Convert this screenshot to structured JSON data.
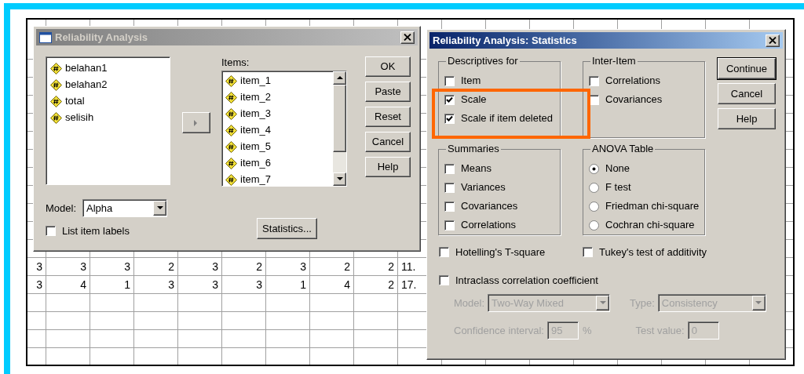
{
  "spreadsheet": {
    "rows": [
      {
        "cells": [
          "3",
          "3",
          "3",
          "2",
          "3",
          "2",
          "3",
          "2",
          "2",
          "11."
        ]
      },
      {
        "cells": [
          "3",
          "4",
          "1",
          "3",
          "3",
          "3",
          "1",
          "4",
          "2",
          "17."
        ]
      }
    ]
  },
  "analysis_dialog": {
    "title": "Reliability Analysis",
    "active": false,
    "variables": [
      {
        "name": "belahan1"
      },
      {
        "name": "belahan2"
      },
      {
        "name": "total"
      },
      {
        "name": "selisih"
      }
    ],
    "items_label": "Items:",
    "items": [
      {
        "name": "item_1"
      },
      {
        "name": "item_2"
      },
      {
        "name": "item_3"
      },
      {
        "name": "item_4"
      },
      {
        "name": "item_5"
      },
      {
        "name": "item_6"
      },
      {
        "name": "item_7"
      }
    ],
    "model_label": "Model:",
    "model_value": "Alpha",
    "list_item_labels": {
      "label": "List item labels",
      "checked": false
    },
    "buttons": [
      "OK",
      "Paste",
      "Reset",
      "Cancel",
      "Help"
    ],
    "statistics_button": "Statistics..."
  },
  "statistics_dialog": {
    "title": "Reliability Analysis: Statistics",
    "active": true,
    "groups": [
      {
        "title": "Descriptives for",
        "kind": "checkbox",
        "options": [
          {
            "label": "Item",
            "checked": false
          },
          {
            "label": "Scale",
            "checked": true
          },
          {
            "label": "Scale if item deleted",
            "checked": true
          }
        ]
      },
      {
        "title": "Inter-Item",
        "kind": "checkbox",
        "options": [
          {
            "label": "Correlations",
            "checked": false
          },
          {
            "label": "Covariances",
            "checked": false
          }
        ]
      },
      {
        "title": "Summaries",
        "kind": "checkbox",
        "options": [
          {
            "label": "Means",
            "checked": false
          },
          {
            "label": "Variances",
            "checked": false
          },
          {
            "label": "Covariances",
            "checked": false
          },
          {
            "label": "Correlations",
            "checked": false
          }
        ]
      },
      {
        "title": "ANOVA Table",
        "kind": "radio",
        "options": [
          {
            "label": "None",
            "selected": true
          },
          {
            "label": "F test",
            "selected": false
          },
          {
            "label": "Friedman chi-square",
            "selected": false
          },
          {
            "label": "Cochran chi-square",
            "selected": false
          }
        ]
      }
    ],
    "hotelling": {
      "label": "Hotelling's T-square",
      "checked": false
    },
    "tukey": {
      "label": "Tukey's test of additivity",
      "checked": false
    },
    "intraclass": {
      "label": "Intraclass correlation coefficient",
      "checked": false
    },
    "icc_settings": {
      "disabled": true,
      "model_label": "Model:",
      "model_value": "Two-Way Mixed",
      "type_label": "Type:",
      "type_value": "Consistency",
      "confidence_label": "Confidence interval:",
      "confidence_value": "95",
      "percent": "%",
      "test_label": "Test value:",
      "test_value": "0"
    },
    "buttons": [
      {
        "label": "Continue",
        "default": true
      },
      {
        "label": "Cancel",
        "default": false
      },
      {
        "label": "Help",
        "default": false
      }
    ]
  },
  "annotation": {
    "kind": "highlight"
  }
}
